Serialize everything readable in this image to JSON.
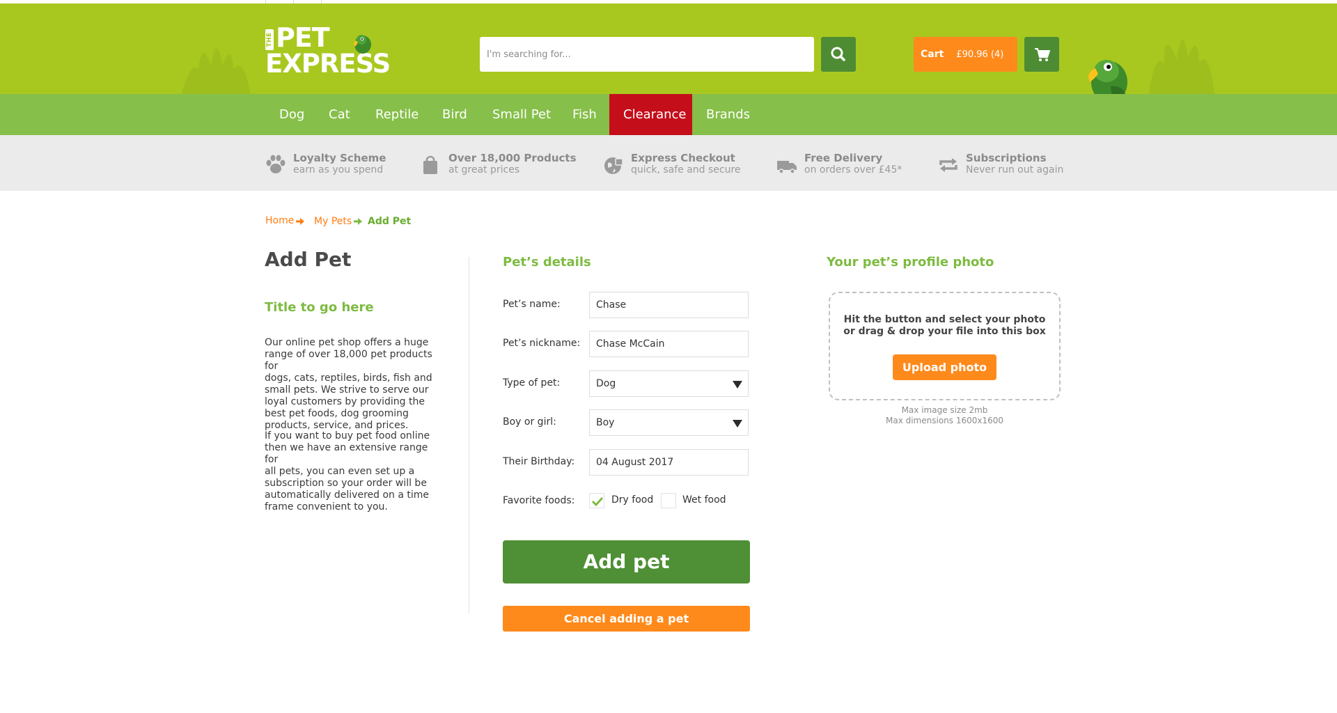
{
  "brand": {
    "logo_small": "THE",
    "logo_line1": "PET",
    "logo_line2": "EXPRESS"
  },
  "search": {
    "placeholder": "I'm searching for..."
  },
  "cart": {
    "label": "Cart",
    "amount": "£90.96 (4)"
  },
  "nav": {
    "items": [
      {
        "label": "Dog"
      },
      {
        "label": "Cat"
      },
      {
        "label": "Reptile"
      },
      {
        "label": "Bird"
      },
      {
        "label": "Small Pet"
      },
      {
        "label": "Fish"
      },
      {
        "label": "Clearance",
        "active": true
      },
      {
        "label": "Brands"
      }
    ]
  },
  "usp": [
    {
      "title": "Loyalty Scheme",
      "sub": "earn as you spend",
      "icon": "paw-icon"
    },
    {
      "title": "Over 18,000 Products",
      "sub": "at great prices",
      "icon": "bag-icon"
    },
    {
      "title": "Express Checkout",
      "sub": "quick, safe and secure",
      "icon": "globe-lock-icon"
    },
    {
      "title": "Free Delivery",
      "sub": "on orders over £45*",
      "icon": "truck-icon"
    },
    {
      "title": "Subscriptions",
      "sub": "Never run out again",
      "icon": "repeat-icon"
    }
  ],
  "breadcrumb": {
    "home": "Home",
    "my_pets": "My Pets",
    "current": "Add Pet"
  },
  "left": {
    "title": "Add Pet",
    "subtitle": "Title to go here",
    "para1_lines": [
      "Our online pet shop offers a huge",
      "range of over 18,000 pet products for",
      "dogs, cats, reptiles, birds, fish and",
      "small pets. We strive to serve our",
      "loyal customers by providing the",
      "best pet foods, dog grooming",
      "products, service, and prices."
    ],
    "para2_lines": [
      "If you want to buy pet food online",
      "then we have an extensive range for",
      "all pets, you can even set up a",
      "subscription so your order will be",
      "automatically delivered on a time",
      "frame convenient to you."
    ]
  },
  "form": {
    "title": "Pet’s details",
    "name_label": "Pet’s name:",
    "name_value": "Chase",
    "nickname_label": "Pet’s nickname:",
    "nickname_value": "Chase McCain",
    "type_label": "Type of pet:",
    "type_value": "Dog",
    "gender_label": "Boy or girl:",
    "gender_value": "Boy",
    "birthday_label": "Their Birthday:",
    "birthday_value": "04 August 2017",
    "foods_label": "Favorite foods:",
    "foods": [
      {
        "label": "Dry food",
        "checked": true
      },
      {
        "label": "Wet food",
        "checked": false
      }
    ],
    "submit": "Add pet",
    "cancel": "Cancel adding a pet"
  },
  "photo": {
    "title": "Your pet’s profile photo",
    "drop_line1": "Hit the button and select your photo",
    "drop_line2": "or drag & drop your file into this box",
    "upload": "Upload photo",
    "hint1": "Max image size 2mb",
    "hint2": "Max dimensions 1600x1600"
  },
  "colors": {
    "header_green": "#a8c81f",
    "nav_green": "#86bf4a",
    "dark_green": "#4e8c34",
    "orange": "#ff8a1c",
    "clearance_red": "#c40f1b",
    "title_green": "#7dbb41"
  }
}
